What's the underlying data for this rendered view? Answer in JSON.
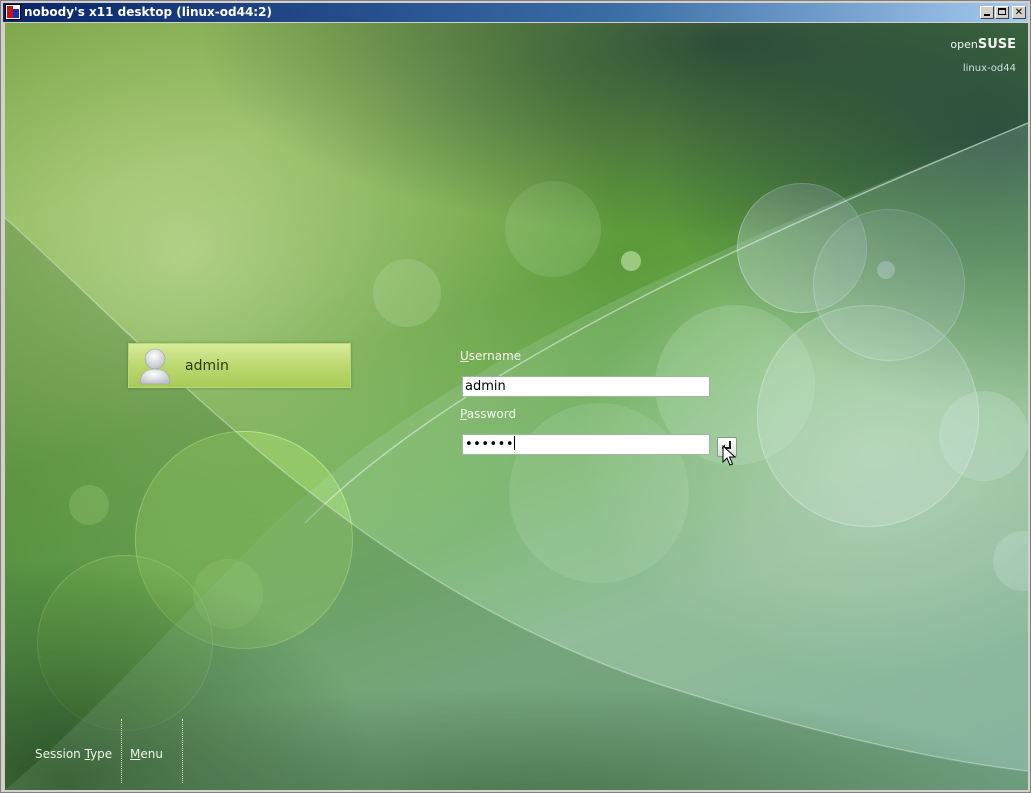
{
  "window": {
    "title": "nobody's x11 desktop (linux-od44:2)",
    "controls": {
      "minimize": "_",
      "maximize": "",
      "close": "✕"
    }
  },
  "branding": {
    "logo_prefix": "open",
    "logo_brand": "SUSE",
    "hostname": "linux-od44"
  },
  "users": [
    {
      "name": "admin",
      "icon": "user-avatar-icon",
      "selected": true
    }
  ],
  "login": {
    "username_label": "Username",
    "username_value": "admin",
    "password_label": "Password",
    "password_masked": "••••••",
    "submit_icon": "enter-arrow-icon"
  },
  "bottom_menu": {
    "session_type_prefix": "Session ",
    "session_type_mnemonic": "T",
    "session_type_suffix": "ype",
    "menu_mnemonic": "M",
    "menu_suffix": "enu"
  },
  "colors": {
    "titlebar_start": "#0a246a",
    "user_item_bg": "#bcd870",
    "desktop_green": "#6fae5a"
  }
}
